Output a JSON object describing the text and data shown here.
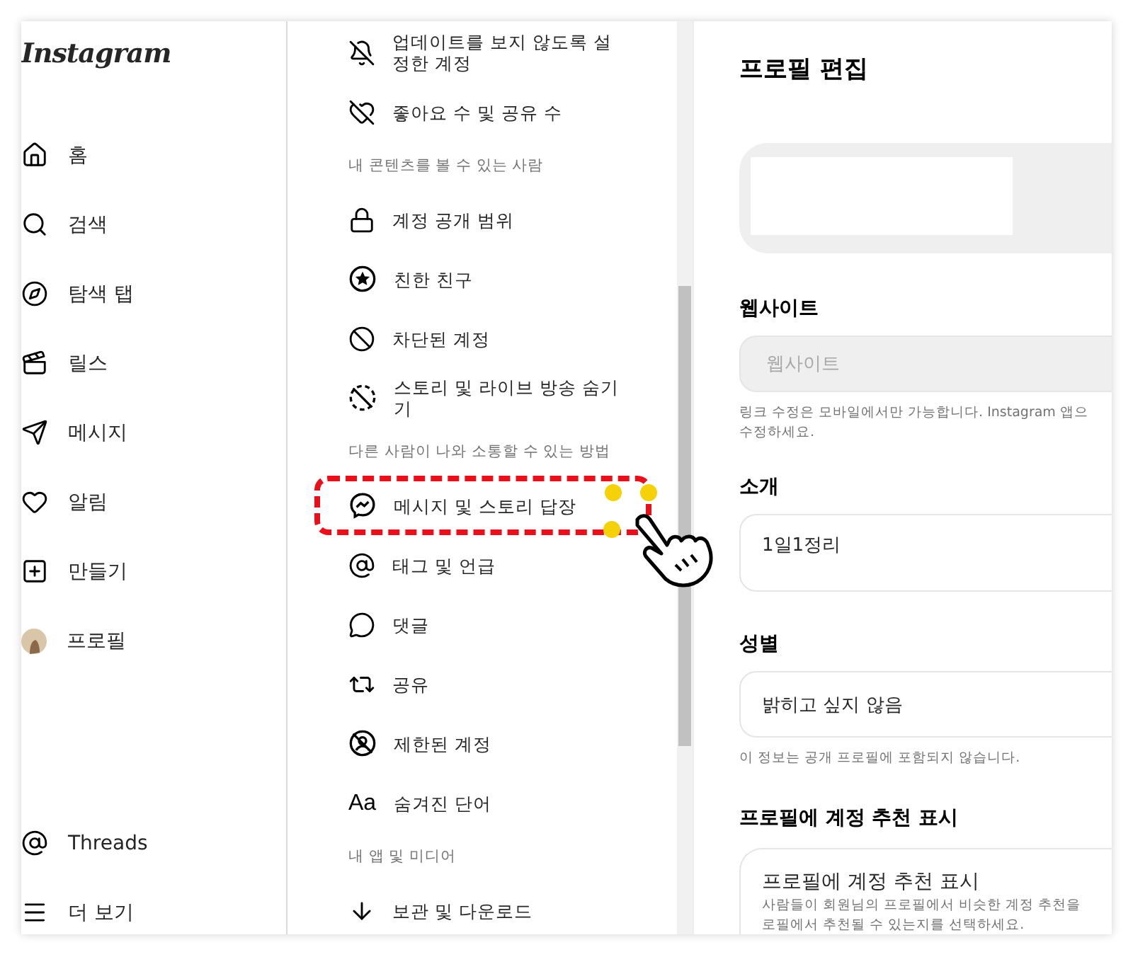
{
  "sidebar": {
    "logo": "Instagram",
    "items": [
      {
        "label": "홈"
      },
      {
        "label": "검색"
      },
      {
        "label": "탐색 탭"
      },
      {
        "label": "릴스"
      },
      {
        "label": "메시지"
      },
      {
        "label": "알림"
      },
      {
        "label": "만들기"
      },
      {
        "label": "프로필",
        "kind": "avatar"
      }
    ],
    "bottom_items": [
      {
        "label": "Threads"
      },
      {
        "label": "더 보기"
      }
    ]
  },
  "settings": {
    "sections": [
      {
        "items": [
          {
            "label": "업데이트를 보지 않도록 설정한 계정",
            "highlighted": false
          },
          {
            "label": "좋아요 수 및 공유 수",
            "highlighted": false
          }
        ]
      },
      {
        "header": "내 콘텐츠를 볼 수 있는 사람",
        "items": [
          {
            "label": "계정 공개 범위",
            "highlighted": false
          },
          {
            "label": "친한 친구",
            "highlighted": false
          },
          {
            "label": "차단된 계정",
            "highlighted": false
          },
          {
            "label": "스토리 및 라이브 방송 숨기기",
            "highlighted": false
          }
        ]
      },
      {
        "header": "다른 사람이 나와 소통할 수 있는 방법",
        "items": [
          {
            "label": "메시지 및 스토리 답장",
            "highlighted": true
          },
          {
            "label": "태그 및 언급",
            "highlighted": false
          },
          {
            "label": "댓글",
            "highlighted": false
          },
          {
            "label": "공유",
            "highlighted": false
          },
          {
            "label": "제한된 계정",
            "highlighted": false
          },
          {
            "label": "숨겨진 단어",
            "icon_text": "Aa",
            "highlighted": false
          }
        ]
      },
      {
        "header": "내 앱 및 미디어",
        "items": [
          {
            "label": "보관 및 다운로드",
            "highlighted": false
          }
        ]
      }
    ]
  },
  "edit_profile": {
    "title": "프로필 편집",
    "website": {
      "label": "웹사이트",
      "placeholder": "웹사이트",
      "disabled": true,
      "help": [
        "링크 수정은 모바일에서만 가능합니다. Instagram 앱으",
        "수정하세요."
      ]
    },
    "bio": {
      "label": "소개",
      "value": "1일1정리"
    },
    "gender": {
      "label": "성별",
      "value": "밝히고 싶지 않음",
      "help": "이 정보는 공개 프로필에 포함되지 않습니다."
    },
    "suggestions": {
      "label": "프로필에 계정 추천 표시",
      "title": "프로필에 계정 추천 표시",
      "description": [
        "사람들이 회원님의 프로필에서 비슷한 계정 추천을",
        "로필에서 추천될 수 있는지를 선택하세요."
      ]
    }
  }
}
